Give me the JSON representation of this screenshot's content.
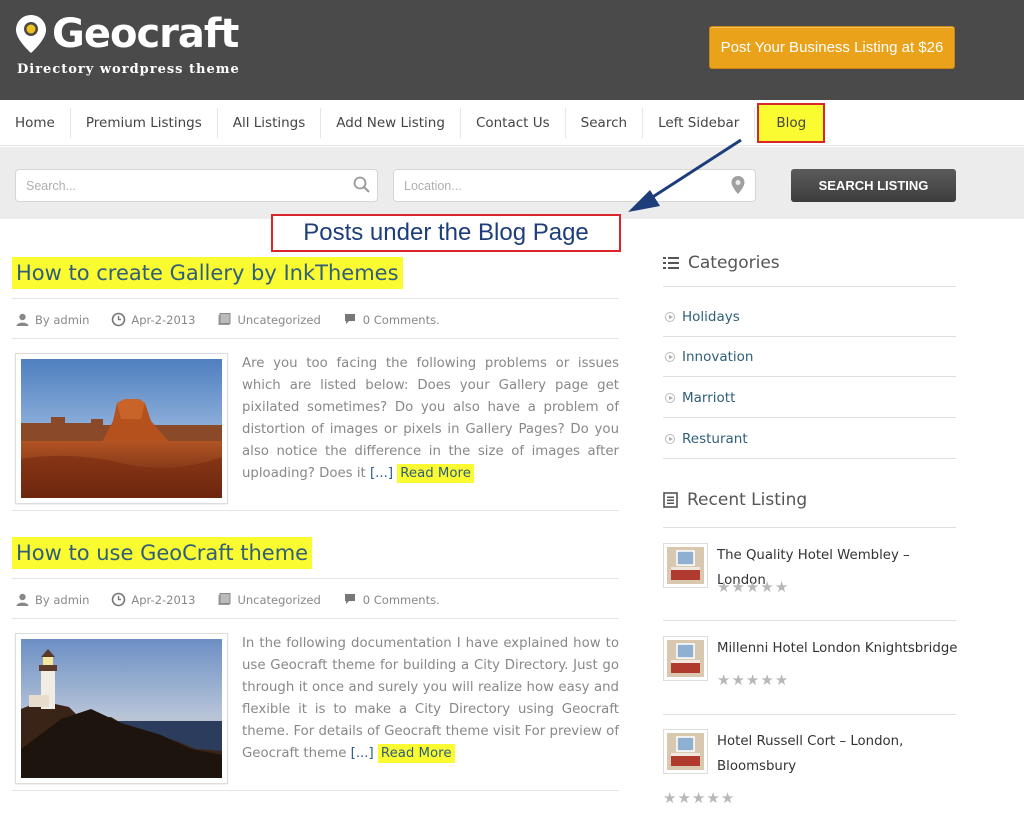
{
  "site": {
    "name": "Geocraft",
    "tagline": "Directory wordpress theme",
    "cta_label": "Post Your Business Listing at $26"
  },
  "nav": {
    "items": [
      "Home",
      "Premium Listings",
      "All Listings",
      "Add New Listing",
      "Contact Us",
      "Search",
      "Left Sidebar",
      "Blog"
    ]
  },
  "search": {
    "search_placeholder": "Search...",
    "location_placeholder": "Location...",
    "button_label": "SEARCH LISTING"
  },
  "annotation": {
    "text": "Posts under the Blog Page",
    "color": "#d9262b"
  },
  "posts": [
    {
      "title": "How to create Gallery by InkThemes",
      "author": "By admin",
      "date": "Apr-2-2013",
      "category": "Uncategorized",
      "comments": "0 Comments.",
      "excerpt": "Are you too facing the following problems or issues which are listed below: Does your Gallery page get pixilated sometimes? Do you also have a problem of distortion of images or pixels in Gallery Pages? Do you also notice the difference in the size of images after uploading? Does it",
      "ellipsis": "[...]",
      "read_more": "Read More"
    },
    {
      "title": "How to use GeoCraft theme",
      "author": "By admin",
      "date": "Apr-2-2013",
      "category": "Uncategorized",
      "comments": "0 Comments.",
      "excerpt": "In the following documentation I have explained how to use Geocraft theme for building a City Directory. Just go through it once and surely you will realize how easy and flexible it is to make a City Directory using Geocraft theme. For details of Geocraft theme visit For preview of Geocraft theme",
      "ellipsis": "[...]",
      "read_more": "Read More"
    }
  ],
  "sidebar": {
    "categories_title": "Categories",
    "categories": [
      "Holidays",
      "Innovation",
      "Marriott",
      "Resturant"
    ],
    "recent_title": "Recent Listing",
    "recent": [
      {
        "title": "The Quality Hotel Wembley – London",
        "rating": 0
      },
      {
        "title": "Millenni Hotel London Knightsbridge",
        "rating": 0
      },
      {
        "title": "Hotel Russell Cort – London, Bloomsbury",
        "rating": 0
      }
    ]
  },
  "colors": {
    "header_bg": "#4a4a4a",
    "cta_bg": "#eaa21a",
    "highlight": "#fbfb32",
    "link": "#2f5f79"
  }
}
